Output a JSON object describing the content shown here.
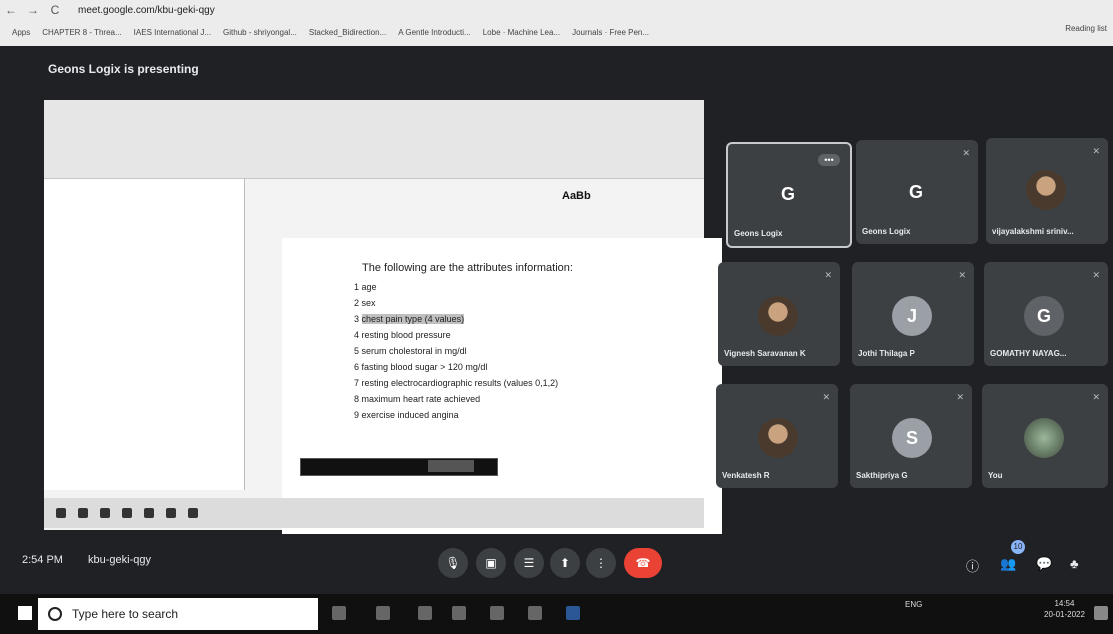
{
  "browser": {
    "url": "meet.google.com/kbu-geki-qgy",
    "nav_back": "←",
    "nav_forward": "→",
    "nav_reload": "C",
    "bookmarks": [
      "Apps",
      "CHAPTER 8 - Threa...",
      "IAES International J...",
      "Github - shriyongal...",
      "Stacked_Bidirection...",
      "A Gentle Introducti...",
      "Lobe · Machine Lea...",
      "Journals · Free Pen..."
    ],
    "reading_list": "Reading list"
  },
  "meet": {
    "presenting": "Geons Logix is presenting",
    "presenter_initial": "G"
  },
  "shared_doc": {
    "heading": "The following are the attributes information:",
    "attributes": [
      {
        "num": "1",
        "text": "age",
        "highlight": false
      },
      {
        "num": "2",
        "text": "sex",
        "highlight": false
      },
      {
        "num": "3",
        "text": "chest pain type (4 values)",
        "highlight": true
      },
      {
        "num": "4",
        "text": "resting blood pressure",
        "highlight": false
      },
      {
        "num": "5",
        "text": "serum cholestoral in mg/dl",
        "highlight": false
      },
      {
        "num": "6",
        "text": "fasting blood sugar > 120 mg/dl",
        "highlight": false
      },
      {
        "num": "7",
        "text": "resting electrocardiographic results (values 0,1,2)",
        "highlight": false
      },
      {
        "num": "8",
        "text": "maximum heart rate achieved",
        "highlight": false
      },
      {
        "num": "9",
        "text": "exercise induced angina",
        "highlight": false
      }
    ],
    "ribbon_style": "AaBb"
  },
  "participants": [
    {
      "name": "Geons Logix",
      "initial": "G"
    },
    {
      "name": "Geons Logix",
      "initial": "G"
    },
    {
      "name": "vijayalakshmi sriniv...",
      "initial": ""
    },
    {
      "name": "Vignesh Saravanan K",
      "initial": ""
    },
    {
      "name": "Jothi Thilaga P",
      "initial": "J"
    },
    {
      "name": "GOMATHY NAYAG...",
      "initial": "G"
    },
    {
      "name": "Venkatesh R",
      "initial": ""
    },
    {
      "name": "Sakthipriya G",
      "initial": "S"
    },
    {
      "name": "You",
      "initial": ""
    }
  ],
  "bottom": {
    "time": "2:54 PM",
    "meeting_code": "kbu-geki-qgy",
    "participant_count": "10"
  },
  "windows": {
    "search_placeholder": "Type here to search",
    "lang": "ENG",
    "clock_time": "14:54",
    "clock_date": "20-01-2022"
  }
}
